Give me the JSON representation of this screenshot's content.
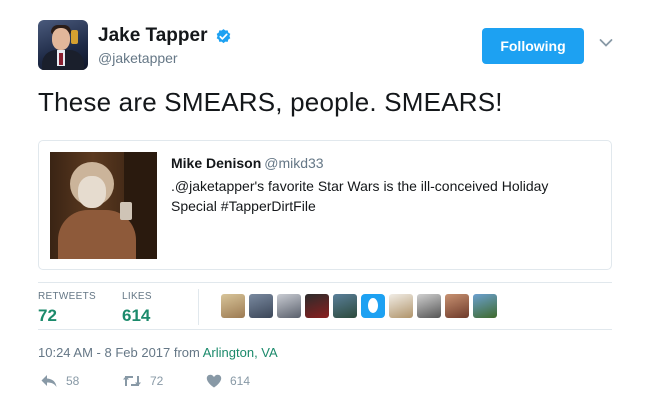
{
  "author": {
    "name": "Jake Tapper",
    "handle": "@jaketapper",
    "verified_icon": "verified-badge-icon"
  },
  "follow_button": {
    "label": "Following"
  },
  "tweet": {
    "text": "These are SMEARS, people. SMEARS!"
  },
  "quote": {
    "name": "Mike Denison",
    "handle": "@mikd33",
    "text": ".@jaketapper's favorite Star Wars is the ill-conceived Holiday Special #TapperDirtFile"
  },
  "stats": {
    "retweets_label": "RETWEETS",
    "retweets": "72",
    "likes_label": "LIKES",
    "likes": "614",
    "liker_avatar_count": 10
  },
  "meta": {
    "time": "10:24 AM - 8 Feb 2017 from ",
    "location": "Arlington, VA"
  },
  "actions": {
    "reply_count": "58",
    "retweet_count": "72",
    "like_count": "614"
  },
  "colors": {
    "accent": "#1da1f2",
    "count_green": "#1b8a6b",
    "muted": "#657786"
  }
}
